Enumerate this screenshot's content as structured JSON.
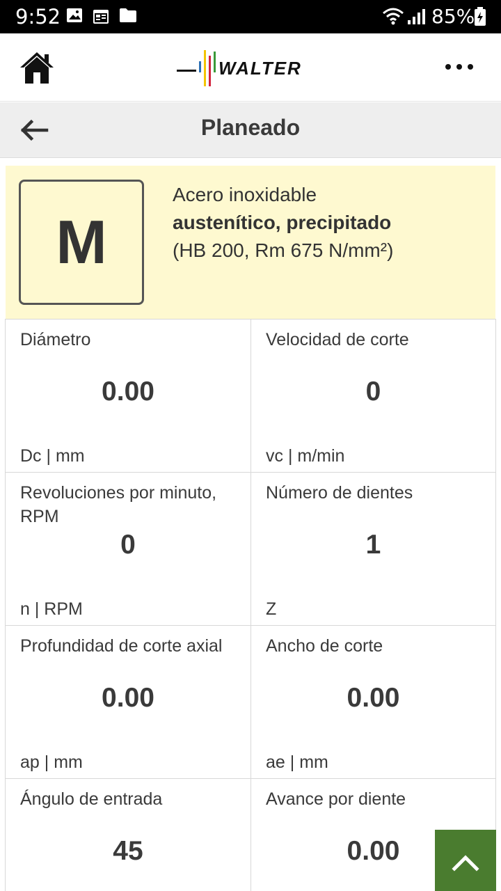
{
  "status_bar": {
    "time": "9:52",
    "battery": "85%",
    "icons": [
      "image-icon",
      "calendar-icon",
      "folder-icon",
      "wifi-icon",
      "signal-icon",
      "battery-charging-icon"
    ]
  },
  "header": {
    "home_icon": "home-icon",
    "logo_text": "WALTER",
    "more_icon": "more-horizontal-icon"
  },
  "titlebar": {
    "back_icon": "arrow-left-icon",
    "title": "Planeado"
  },
  "material": {
    "group": "M",
    "line1": "Acero inoxidable",
    "line2": "austenítico, precipitado",
    "line3": "(HB 200, Rm 675 N/mm²)",
    "background": "#fef9d0"
  },
  "parameters": [
    {
      "label": "Diámetro",
      "value": "0.00",
      "unit": "Dc | mm"
    },
    {
      "label": "Velocidad de corte",
      "value": "0",
      "unit": "vc | m/min"
    },
    {
      "label": "Revoluciones por minuto, RPM",
      "value": "0",
      "unit": "n | RPM"
    },
    {
      "label": "Número de dientes",
      "value": "1",
      "unit": "Z"
    },
    {
      "label": "Profundidad de corte axial",
      "value": "0.00",
      "unit": "ap | mm"
    },
    {
      "label": "Ancho de corte",
      "value": "0.00",
      "unit": "ae | mm"
    },
    {
      "label": "Ángulo de entrada",
      "value": "45",
      "unit": ""
    },
    {
      "label": "Avance por diente",
      "value": "0.00",
      "unit": ""
    }
  ],
  "scroll_top": {
    "icon": "chevron-up-icon",
    "color": "#4a7c2f"
  }
}
